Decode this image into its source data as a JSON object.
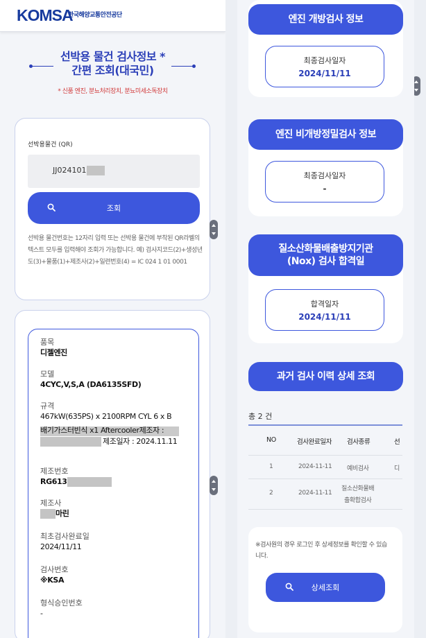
{
  "header": {
    "logo": "KOMSA",
    "org_name": "한국해양교통안전공단"
  },
  "title": {
    "line1": "선박용 물건 검사정보 *",
    "line2": "간편 조회(대국민)",
    "note": "* 신품 엔진, 분뇨처리장치, 분뇨미세소독장치"
  },
  "search": {
    "label": "선박용물건 (QR)",
    "value": "JJ024101",
    "button_label": "조회",
    "help_text": "선박용 물건번호는 12자리 입력 또는 선박용 물건에 부착된 QR라벨의 텍스트 모두를 입력해야 조회가 가능합니다. 예) 검사지코드(2)+생성년도(3)+물품(1)+제조사(2)+일련번호(4) = IC 024 1 01 0001"
  },
  "info": {
    "product_label": "품목",
    "product_value": "디젤엔진",
    "model_label": "모델",
    "model_value": "4CYC,V,S,A (DA6135SFD)",
    "spec_label": "규격",
    "spec_line1": "467kW(635PS) x 2100RPM CYL 6 x B",
    "spec_line2": "배기가스터빈식 x1 Aftercooler제조자 :",
    "spec_line3": "제조일자 : 2024.11.11",
    "serial_label": "제조번호",
    "serial_value": "RG613",
    "maker_label": "제조사",
    "maker_value": "마린",
    "first_insp_label": "최초검사완료일",
    "first_insp_value": "2024/11/11",
    "insp_no_label": "검사번호",
    "insp_no_value": "※KSA",
    "type_approval_label": "형식승인번호",
    "type_approval_value": "-"
  },
  "right": {
    "open_insp": {
      "title": "엔진 개방검사 정보",
      "label": "최종검사일자",
      "value": "2024/11/11"
    },
    "nonopen_insp": {
      "title": "엔진 비개방정밀검사 정보",
      "label": "최종검사일자",
      "value": "-"
    },
    "nox": {
      "title_line1": "질소산화물배출방지기관",
      "title_line2": "(Nox) 검사 합격일",
      "label": "합격일자",
      "value": "2024/11/11"
    },
    "history": {
      "title": "과거 검사 이력 상세 조회",
      "total": "총 2 건",
      "columns": [
        "NO",
        "검사완료일자",
        "검사종류",
        "선"
      ],
      "rows": [
        {
          "no": "1",
          "date": "2024-11-11",
          "type": "예비검사",
          "extra": "디"
        },
        {
          "no": "2",
          "date": "2024-11-11",
          "type_line1": "질소산화물배",
          "type_line2": "출확합검사",
          "extra": ""
        }
      ]
    },
    "detail": {
      "note": "※검사원의 경우 로그인 후 상세정보를 확인할 수 있습니다.",
      "button_label": "상세조회"
    }
  }
}
